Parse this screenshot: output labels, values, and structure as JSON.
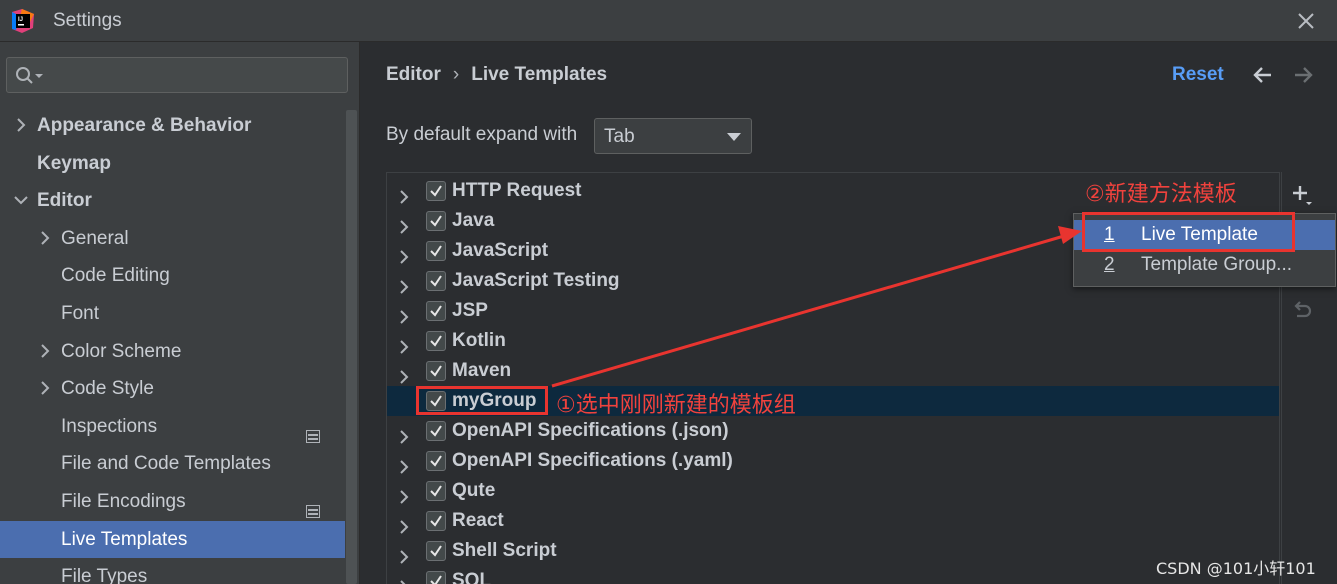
{
  "window": {
    "title": "Settings"
  },
  "sidebar": {
    "search": {
      "value": "",
      "placeholder": ""
    },
    "items": [
      {
        "label": "Appearance & Behavior",
        "level": 0,
        "expander": "collapsed",
        "bold": true
      },
      {
        "label": "Keymap",
        "level": 0,
        "expander": "none",
        "bold": true
      },
      {
        "label": "Editor",
        "level": 0,
        "expander": "expanded",
        "bold": true
      },
      {
        "label": "General",
        "level": 1,
        "expander": "collapsed"
      },
      {
        "label": "Code Editing",
        "level": 1,
        "expander": "none"
      },
      {
        "label": "Font",
        "level": 1,
        "expander": "none"
      },
      {
        "label": "Color Scheme",
        "level": 1,
        "expander": "collapsed"
      },
      {
        "label": "Code Style",
        "level": 1,
        "expander": "collapsed"
      },
      {
        "label": "Inspections",
        "level": 1,
        "expander": "none",
        "badge": "project-settings-icon"
      },
      {
        "label": "File and Code Templates",
        "level": 1,
        "expander": "none"
      },
      {
        "label": "File Encodings",
        "level": 1,
        "expander": "none",
        "badge": "project-settings-icon"
      },
      {
        "label": "Live Templates",
        "level": 1,
        "expander": "none",
        "selected": true
      },
      {
        "label": "File Types",
        "level": 1,
        "expander": "none"
      }
    ]
  },
  "header": {
    "breadcrumb": [
      "Editor",
      "Live Templates"
    ],
    "breadcrumb_sep": "›",
    "reset_label": "Reset",
    "back_icon": "arrow-left-icon",
    "forward_icon": "arrow-right-icon"
  },
  "expand": {
    "label": "By default expand with",
    "selected": "Tab"
  },
  "groups": [
    {
      "name": "HTTP Request",
      "checked": true
    },
    {
      "name": "Java",
      "checked": true
    },
    {
      "name": "JavaScript",
      "checked": true
    },
    {
      "name": "JavaScript Testing",
      "checked": true
    },
    {
      "name": "JSP",
      "checked": true
    },
    {
      "name": "Kotlin",
      "checked": true
    },
    {
      "name": "Maven",
      "checked": true
    },
    {
      "name": "myGroup",
      "checked": true,
      "selected": true,
      "no_expander": true
    },
    {
      "name": "OpenAPI Specifications (.json)",
      "checked": true
    },
    {
      "name": "OpenAPI Specifications (.yaml)",
      "checked": true
    },
    {
      "name": "Qute",
      "checked": true
    },
    {
      "name": "React",
      "checked": true
    },
    {
      "name": "Shell Script",
      "checked": true
    },
    {
      "name": "SQL",
      "checked": true
    }
  ],
  "popup": {
    "items": [
      {
        "mnemonic": "1",
        "label": "Live Template",
        "active": true
      },
      {
        "mnemonic": "2",
        "label": "Template Group..."
      }
    ]
  },
  "annotations": {
    "step1": "①选中刚刚新建的模板组",
    "step2": "②新建方法模板",
    "color": "#e8342f"
  },
  "watermark": "CSDN @101小轩101",
  "colors": {
    "accent": "#4b6eaf",
    "link": "#589df6",
    "selected_row": "#0d293e"
  }
}
